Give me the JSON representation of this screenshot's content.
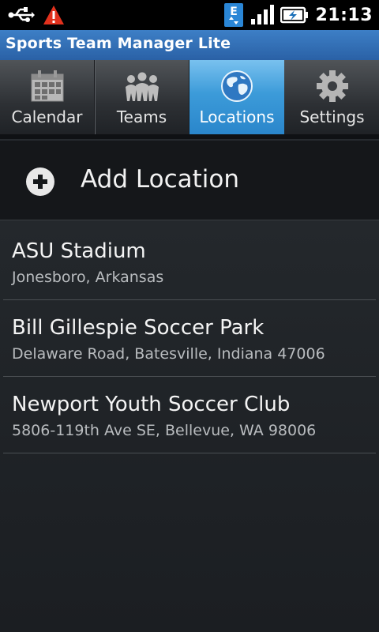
{
  "status_bar": {
    "icons": [
      "usb-icon",
      "warning-icon",
      "network-e-icon",
      "signal-icon",
      "battery-charging-icon"
    ],
    "time": "21:13"
  },
  "app": {
    "title": "Sports Team Manager Lite"
  },
  "tabs": [
    {
      "label": "Calendar",
      "icon": "calendar-icon",
      "active": false
    },
    {
      "label": "Teams",
      "icon": "teams-icon",
      "active": false
    },
    {
      "label": "Locations",
      "icon": "globe-icon",
      "active": true
    },
    {
      "label": "Settings",
      "icon": "gear-icon",
      "active": false
    }
  ],
  "add_location": {
    "label": "Add Location",
    "icon": "plus-circle-icon"
  },
  "locations": [
    {
      "name": "ASU Stadium",
      "address": "Jonesboro, Arkansas"
    },
    {
      "name": "Bill Gillespie Soccer Park",
      "address": "Delaware Road, Batesville, Indiana 47006"
    },
    {
      "name": "Newport Youth Soccer Club",
      "address": "5806-119th Ave SE, Bellevue, WA 98006"
    }
  ],
  "colors": {
    "title_bar": "#2f6db4",
    "active_tab": "#3c9bd9",
    "background": "#23272b"
  }
}
